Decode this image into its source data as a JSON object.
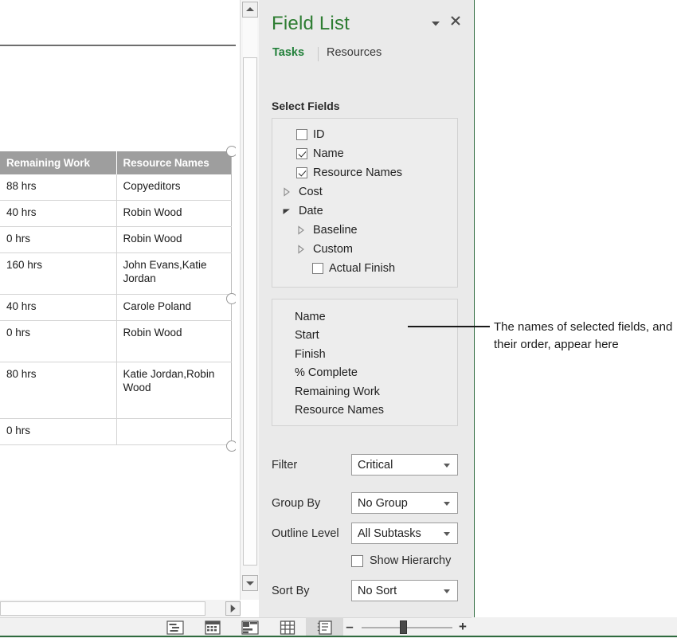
{
  "sheet": {
    "columns": [
      "Remaining Work",
      "Resource Names"
    ],
    "rows": [
      {
        "remaining_work": "88 hrs",
        "resource_names": "Copyeditors"
      },
      {
        "remaining_work": "40 hrs",
        "resource_names": "Robin Wood"
      },
      {
        "remaining_work": "0 hrs",
        "resource_names": "Robin Wood"
      },
      {
        "remaining_work": "160 hrs",
        "resource_names": "John Evans,Katie Jordan"
      },
      {
        "remaining_work": "40 hrs",
        "resource_names": "Carole Poland"
      },
      {
        "remaining_work": "0 hrs",
        "resource_names": "Robin Wood"
      },
      {
        "remaining_work": "80 hrs",
        "resource_names": "Katie Jordan,Robin Wood"
      },
      {
        "remaining_work": "0 hrs",
        "resource_names": ""
      }
    ]
  },
  "pane": {
    "title": "Field List",
    "collapse_icon": "chevron-down-icon",
    "close_icon": "close-icon",
    "tabs": [
      {
        "label": "Tasks",
        "active": true
      },
      {
        "label": "Resources",
        "active": false
      }
    ],
    "select_fields_label": "Select Fields",
    "field_tree": [
      {
        "label": "ID",
        "type": "checkbox",
        "checked": false,
        "indent": 0
      },
      {
        "label": "Name",
        "type": "checkbox",
        "checked": true,
        "indent": 0
      },
      {
        "label": "Resource Names",
        "type": "checkbox",
        "checked": true,
        "indent": 0
      },
      {
        "label": "Cost",
        "type": "group",
        "expanded": false,
        "indent": 0
      },
      {
        "label": "Date",
        "type": "group",
        "expanded": true,
        "indent": 0
      },
      {
        "label": "Baseline",
        "type": "group",
        "expanded": false,
        "indent": 1
      },
      {
        "label": "Custom",
        "type": "group",
        "expanded": false,
        "indent": 1
      },
      {
        "label": "Actual Finish",
        "type": "checkbox",
        "checked": false,
        "indent": 2
      }
    ],
    "selected_fields": [
      "Name",
      "Start",
      "Finish",
      "% Complete",
      "Remaining Work",
      "Resource Names"
    ],
    "controls": {
      "filter_label": "Filter",
      "filter_value": "Critical",
      "group_label": "Group By",
      "group_value": "No Group",
      "outline_label": "Outline Level",
      "outline_value": "All Subtasks",
      "show_hierarchy_label": "Show Hierarchy",
      "show_hierarchy_checked": false,
      "sort_label": "Sort By",
      "sort_value": "No Sort"
    },
    "accent_color": "#2e7d32",
    "active_tab_color": "#22803a"
  },
  "annotation": {
    "text": "The names of selected fields, and their order, appear here"
  },
  "statusbar": {
    "views": [
      {
        "name": "gantt-chart-view-icon",
        "active": false
      },
      {
        "name": "task-usage-view-icon",
        "active": false
      },
      {
        "name": "team-planner-view-icon",
        "active": false
      },
      {
        "name": "resource-sheet-view-icon",
        "active": false
      },
      {
        "name": "report-view-icon",
        "active": true
      }
    ],
    "zoom_out_label": "–",
    "zoom_in_label": "+"
  }
}
